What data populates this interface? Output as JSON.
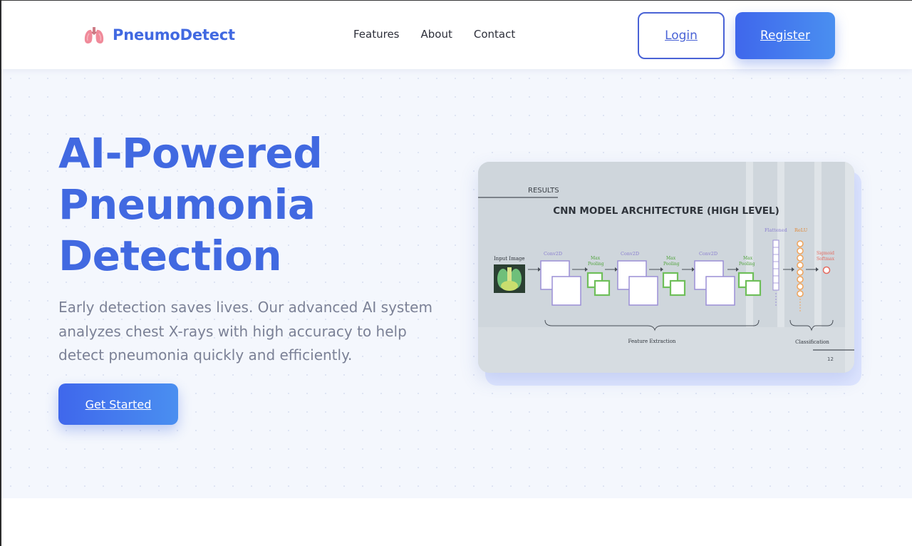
{
  "brand": {
    "name": "PneumoDetect",
    "icon": "lungs-icon"
  },
  "nav": {
    "links": [
      {
        "label": "Features"
      },
      {
        "label": "About"
      },
      {
        "label": "Contact"
      }
    ],
    "login_label": "Login",
    "register_label": "Register"
  },
  "hero": {
    "title_lines": [
      "AI-Powered",
      "Pneumonia",
      "Detection"
    ],
    "subtitle": "Early detection saves lives. Our advanced AI system analyzes chest X-rays with high accuracy to help detect pneumonia quickly and efficiently.",
    "cta_label": "Get Started"
  },
  "figure": {
    "section_label": "RESULTS",
    "title": "CNN MODEL ARCHITECTURE (HIGH LEVEL)",
    "input_label": "Input Image",
    "conv_label": "Conv2D",
    "pool_label_1": "Max",
    "pool_label_2": "Pooling",
    "flattened_label": "Flattened",
    "relu_label": "ReLU",
    "sigmoid_label_1": "Sigmoid",
    "sigmoid_label_2": "Softmax",
    "feature_extraction_label": "Feature Extraction",
    "classification_label": "Classification",
    "page_number": "12"
  },
  "colors": {
    "brand": "#4169e1",
    "button_gradient_start": "#3f67ec",
    "button_gradient_end": "#4a8ff0",
    "hero_bg": "#f4f7fd",
    "conv_purple": "#9b8fd6",
    "pool_green": "#6fbf5a",
    "relu_orange": "#f0a35a",
    "sigmoid_red": "#e46a5e"
  }
}
